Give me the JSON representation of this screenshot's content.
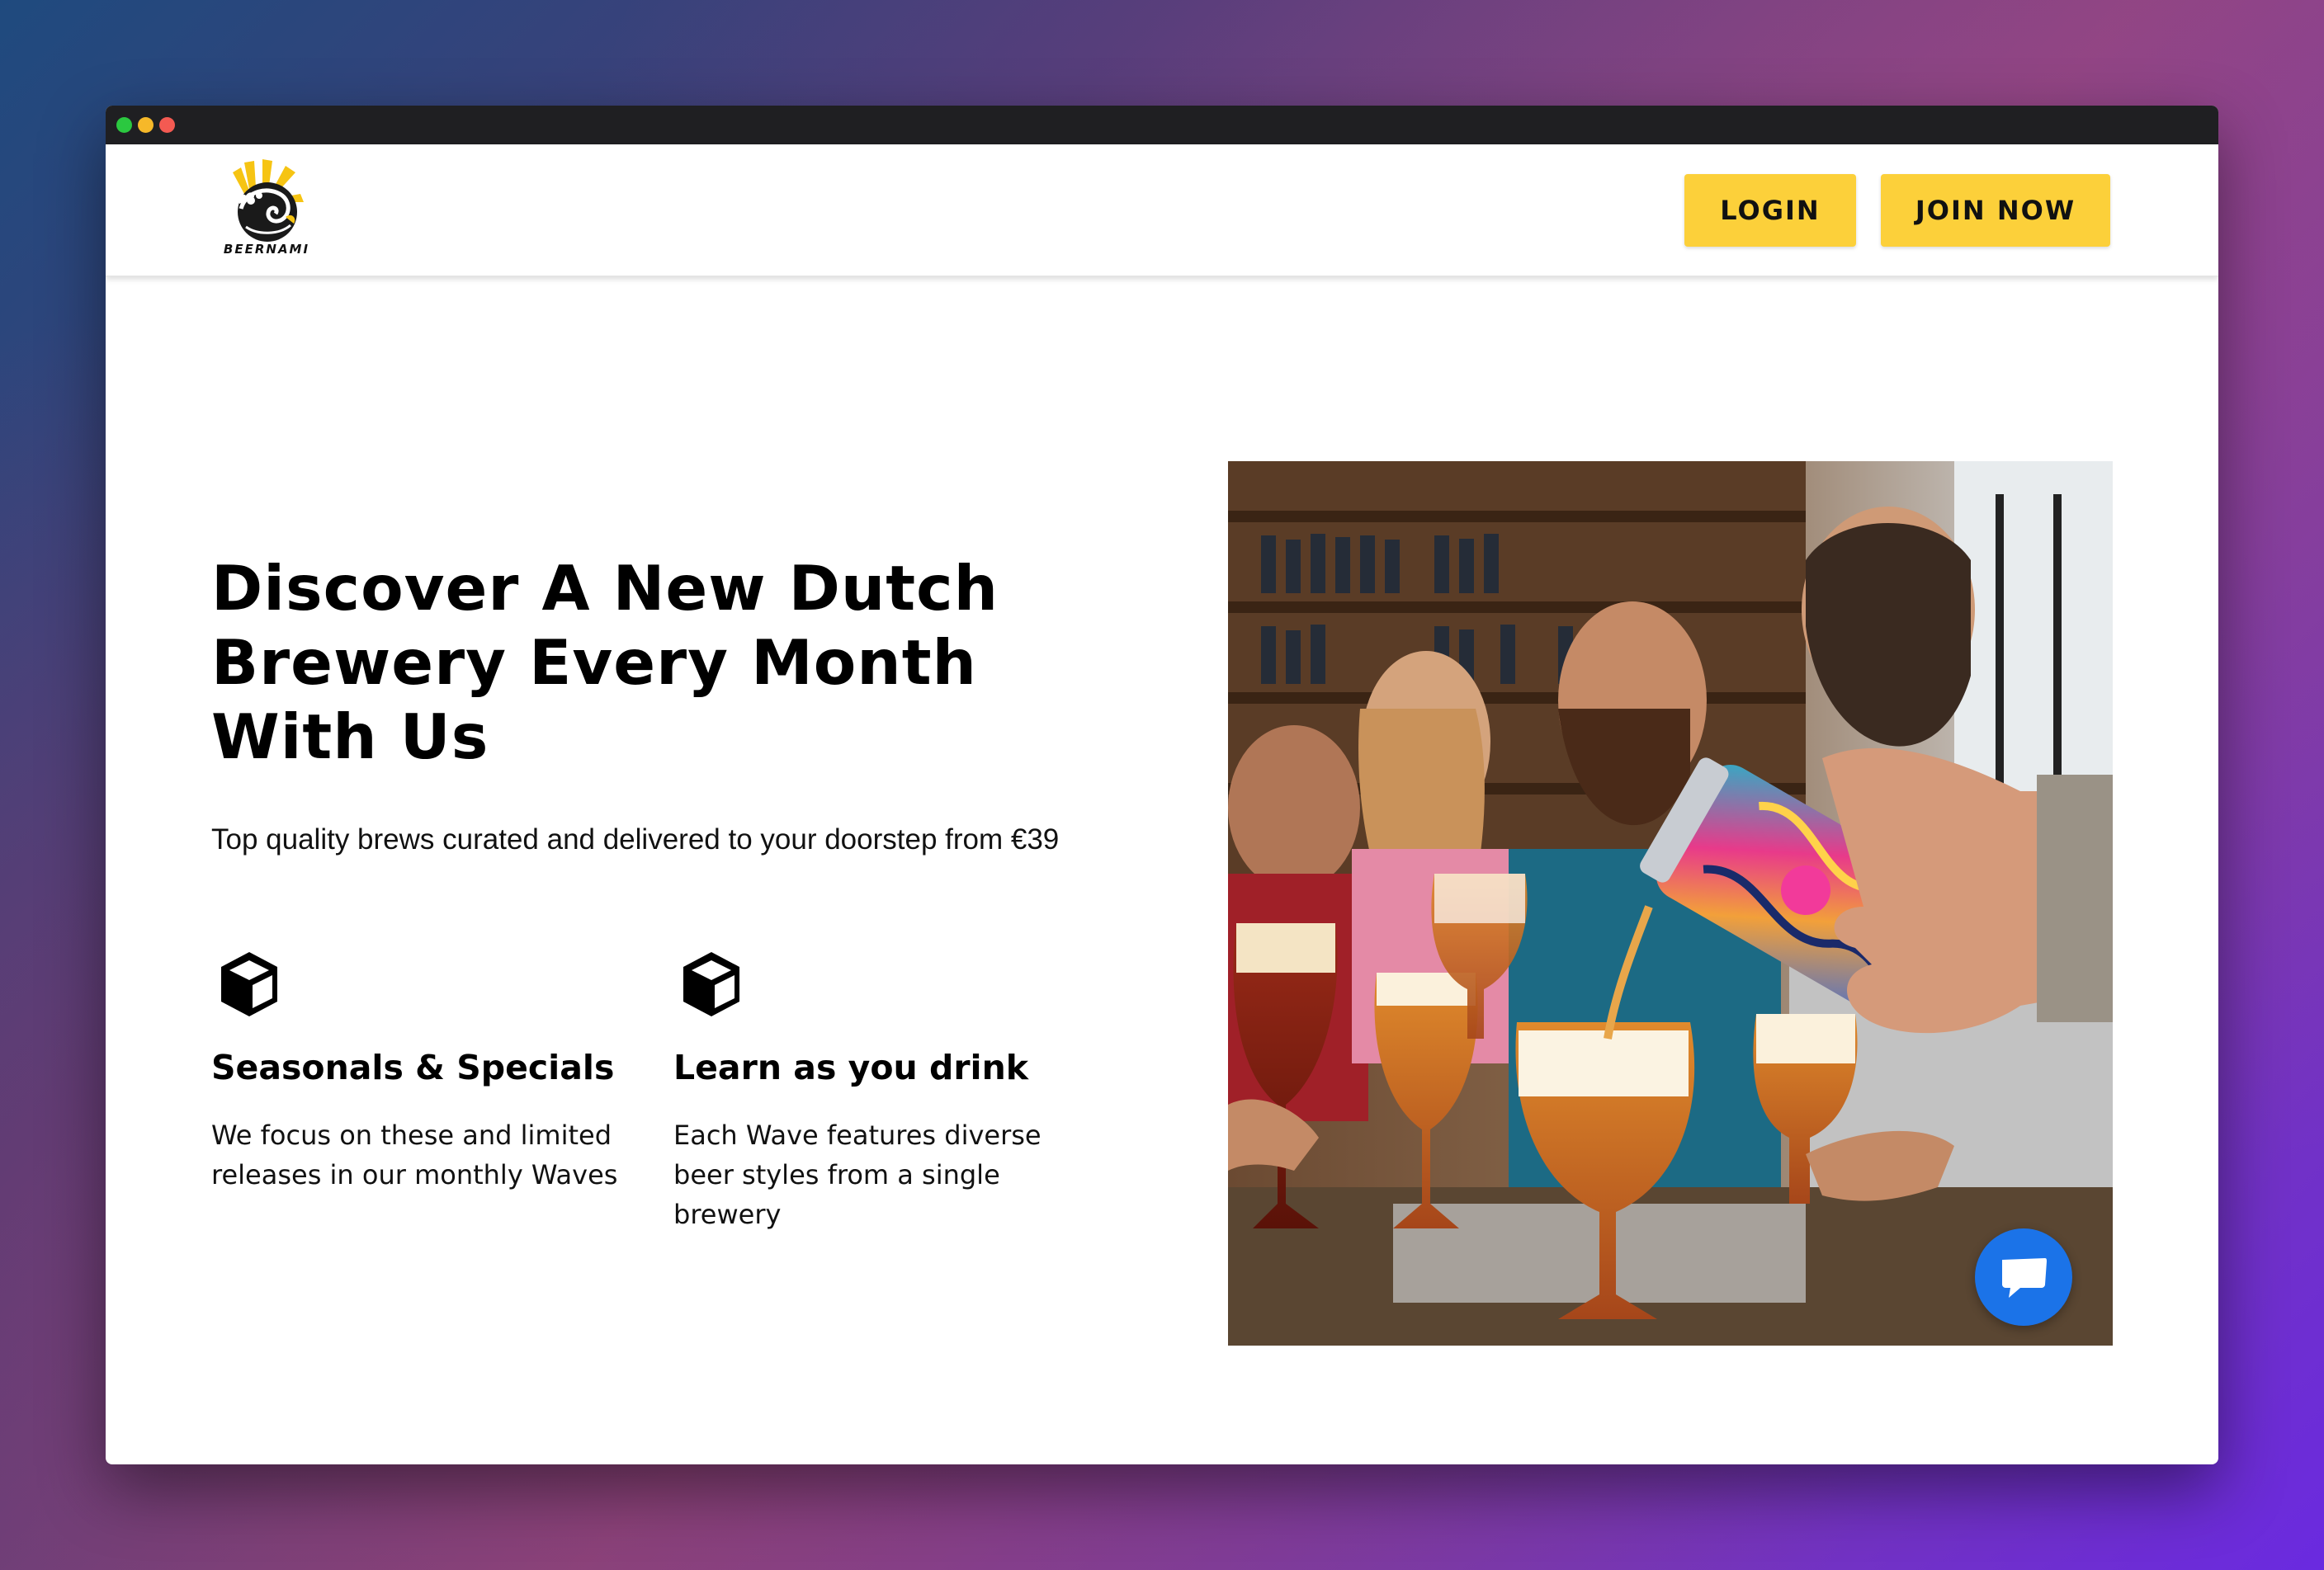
{
  "window": {
    "controls": [
      "green",
      "yellow",
      "red"
    ]
  },
  "header": {
    "logo_text": "BEERNAMI",
    "login_label": "LOGIN",
    "join_label": "JOIN NOW"
  },
  "hero": {
    "title": "Discover A New Dutch Brewery Every Month With Us",
    "subtitle": "Top quality brews curated and delivered to your doorstep from €39",
    "image_description": "Friends toasting with glasses of craft beer while a colorful can is poured"
  },
  "features": [
    {
      "icon": "box-icon",
      "title": "Seasonals & Specials",
      "description": "We focus on these and limited releases in our monthly Waves"
    },
    {
      "icon": "box-icon",
      "title": "Learn as you drink",
      "description": "Each Wave features diverse beer styles from a single brewery"
    }
  ],
  "chat": {
    "icon": "chat-bubble-icon"
  },
  "colors": {
    "accent": "#fcd03a",
    "chat_button": "#1b73e8",
    "titlebar": "#1f1f22"
  }
}
